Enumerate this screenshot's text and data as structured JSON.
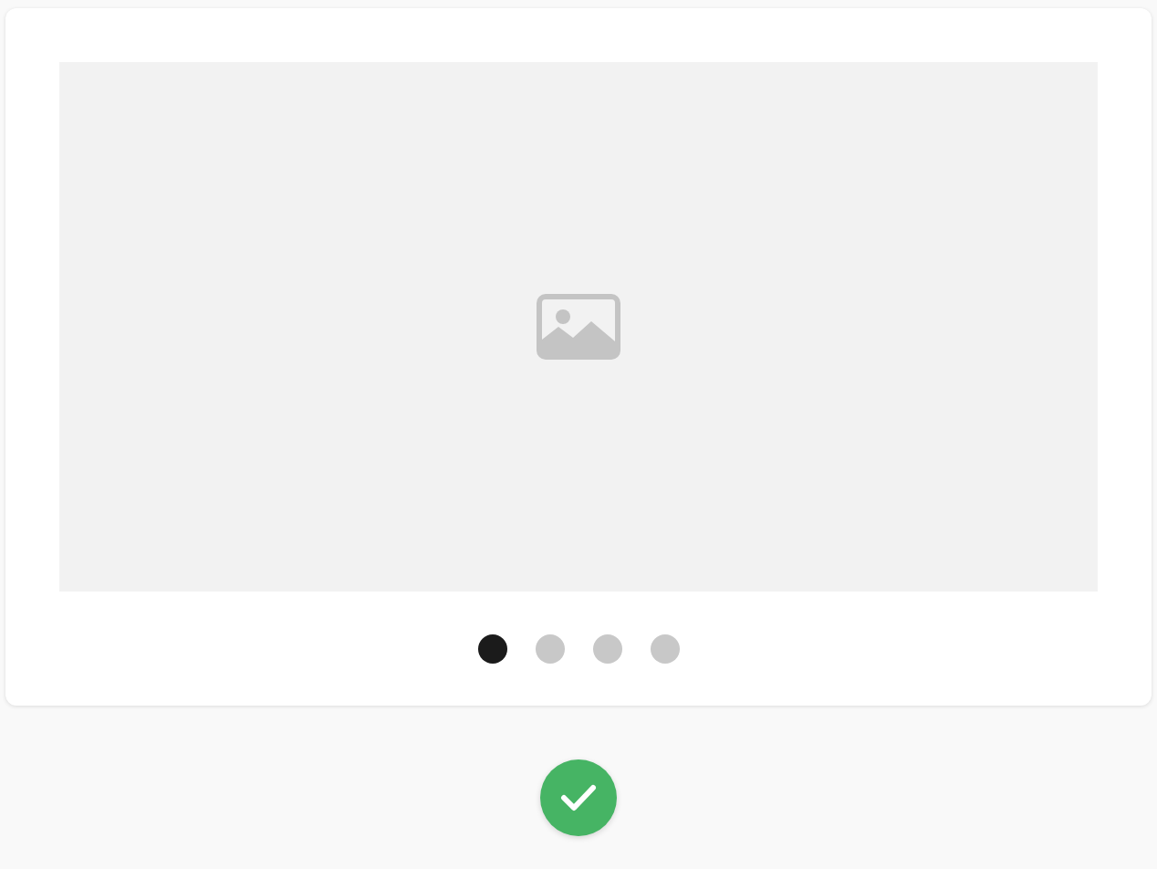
{
  "carousel": {
    "slide": {
      "kind": "placeholder"
    },
    "dots": [
      {
        "selected": true
      },
      {
        "selected": false
      },
      {
        "selected": false
      },
      {
        "selected": false
      }
    ]
  },
  "confirm_button": {
    "kind": "check"
  }
}
